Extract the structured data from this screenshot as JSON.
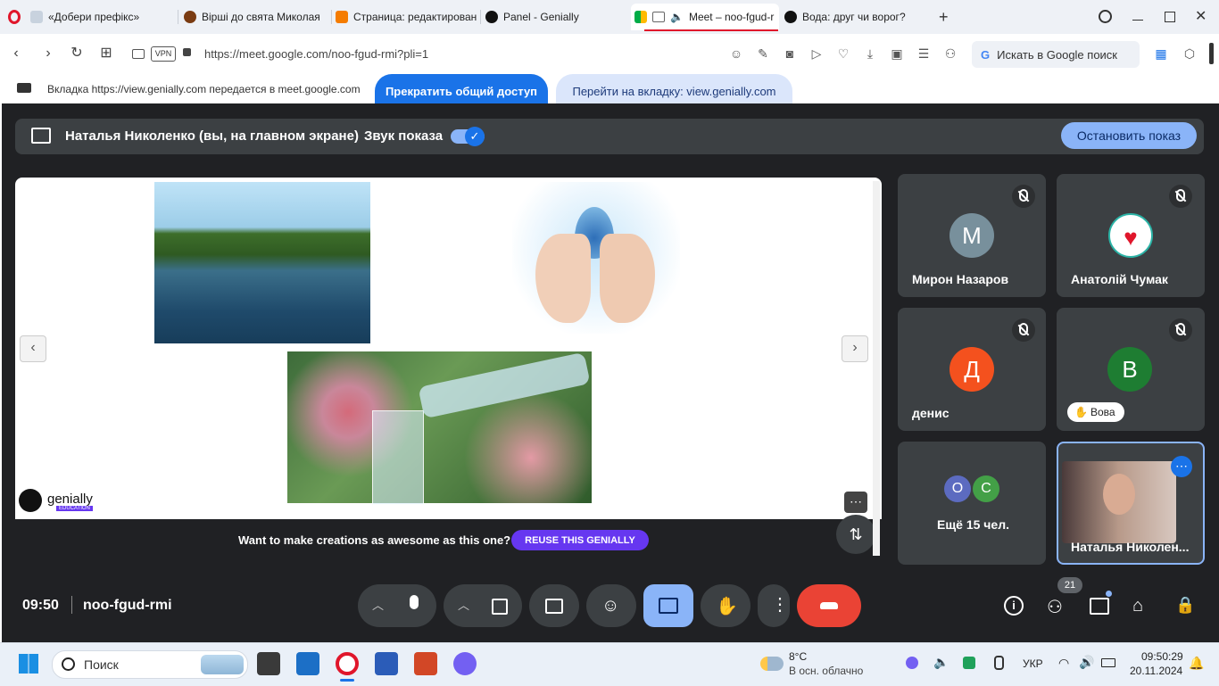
{
  "browser": {
    "tabs": [
      {
        "title": "«Добери префікс»",
        "active": false
      },
      {
        "title": "Вірші до свята Миколая",
        "active": false
      },
      {
        "title": "Страница: редактирован",
        "active": false
      },
      {
        "title": "Panel - Genially",
        "active": false
      },
      {
        "title": "Meet – noo-fgud-r",
        "active": true
      },
      {
        "title": "Вода: друг чи ворог?",
        "active": false
      }
    ],
    "url": "https://meet.google.com/noo-fgud-rmi?pli=1",
    "vpn_label": "VPN",
    "search_placeholder": "Искать в Google поиск"
  },
  "sharebar": {
    "message": "Вкладка https://view.genially.com передается в meet.google.com",
    "stop_label": "Прекратить общий доступ",
    "goto_label": "Перейти на вкладку: view.genially.com"
  },
  "presenting": {
    "title": "Наталья Николенко (вы, на главном экране)",
    "sound_label": "Звук показа",
    "sound_on": true,
    "stop_label": "Остановить показ"
  },
  "slide": {
    "brand": "genially",
    "brand_sub": "EDUCATION",
    "cta_text": "Want to make creations as awesome as this one?",
    "cta_button": "REUSE THIS GENIALLY"
  },
  "participants": [
    {
      "name": "Мирон Назаров",
      "initial": "М",
      "color": "#78909c",
      "muted": true
    },
    {
      "name": "Анатолій Чумак",
      "initial": "",
      "color": "#ffffff",
      "muted": true
    },
    {
      "name": "денис",
      "initial": "Д",
      "color": "#f4511e",
      "muted": true
    },
    {
      "name": "Вова",
      "initial": "В",
      "color": "#1e7d32",
      "muted": true,
      "hand_raised": true
    },
    {
      "name": "Ещё 15 чел.",
      "initial": "",
      "extra_initials": [
        "О",
        "С"
      ],
      "extra_colors": [
        "#5c6bc0",
        "#43a047"
      ]
    },
    {
      "name": "Наталья Николен...",
      "initial": "",
      "self": true
    }
  ],
  "meeting": {
    "time": "09:50",
    "code": "noo-fgud-rmi",
    "participants_count": "21"
  },
  "taskbar": {
    "search_placeholder": "Поиск",
    "weather_temp": "8°C",
    "weather_desc": "В осн. облачно",
    "language": "УКР",
    "clock_time": "09:50:29",
    "clock_date": "20.11.2024"
  }
}
